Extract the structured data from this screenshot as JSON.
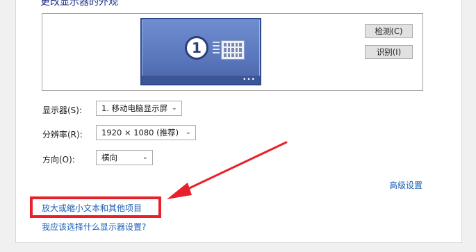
{
  "heading": "更改显示器的外观",
  "preview": {
    "monitor_number": "1",
    "monitor_dots": "•••"
  },
  "buttons": {
    "detect": "检测(C)",
    "identify": "识别(I)"
  },
  "fields": {
    "display_label": "显示器(S):",
    "display_value": "1. 移动电脑显示屏",
    "resolution_label": "分辨率(R):",
    "resolution_value": "1920 × 1080 (推荐)",
    "orientation_label": "方向(O):",
    "orientation_value": "横向"
  },
  "links": {
    "advanced_settings": "高级设置",
    "enlarge_text": "放大或缩小文本和其他项目",
    "which_settings": "我应该选择什么显示器设置?"
  },
  "colors": {
    "link": "#1a5fb4",
    "highlight": "#e8202a",
    "monitor": "#5a77bd"
  },
  "icons": {
    "dropdown": "chevron-down-icon",
    "arrow": "red-arrow-annotation"
  }
}
